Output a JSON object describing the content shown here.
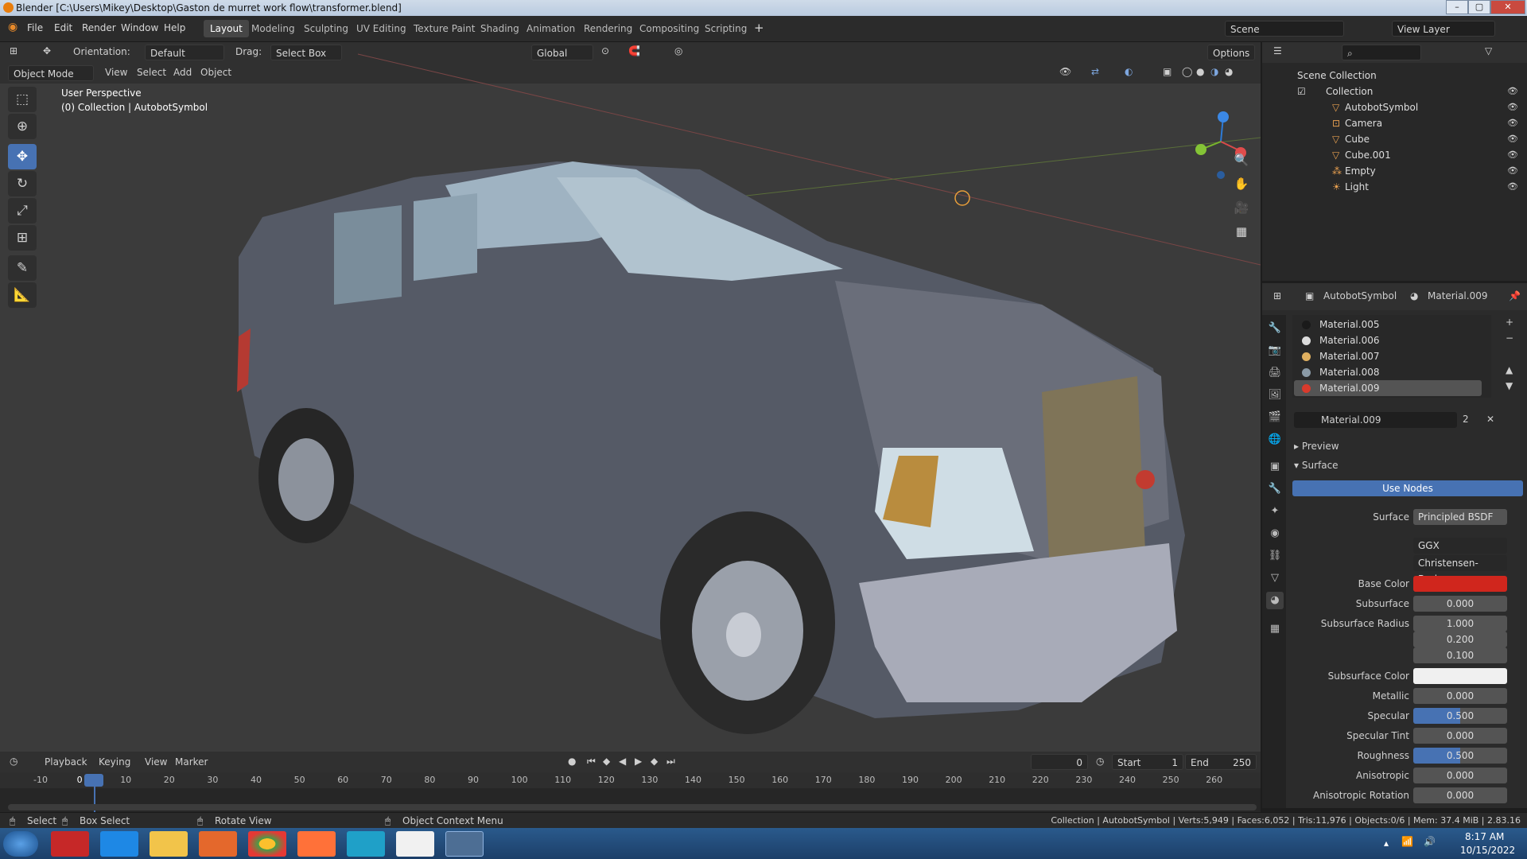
{
  "window": {
    "title": "Blender [C:\\Users\\Mikey\\Desktop\\Gaston de murret work flow\\transformer.blend]"
  },
  "menu": [
    "File",
    "Edit",
    "Render",
    "Window",
    "Help"
  ],
  "workspaces": [
    "Layout",
    "Modeling",
    "Sculpting",
    "UV Editing",
    "Texture Paint",
    "Shading",
    "Animation",
    "Rendering",
    "Compositing",
    "Scripting"
  ],
  "active_workspace": "Layout",
  "scene": {
    "label": "Scene",
    "view_layer": "View Layer"
  },
  "toolheader": {
    "orientation_label": "Orientation:",
    "orientation_value": "Default",
    "drag_label": "Drag:",
    "drag_value": "Select Box",
    "transform": "Global",
    "options": "Options"
  },
  "viewport": {
    "mode": "Object Mode",
    "menus": [
      "View",
      "Select",
      "Add",
      "Object"
    ],
    "info_line1": "User Perspective",
    "info_line2": "(0) Collection | AutobotSymbol"
  },
  "outliner": {
    "root": "Scene Collection",
    "collection": "Collection",
    "items": [
      "AutobotSymbol",
      "Camera",
      "Cube",
      "Cube.001",
      "Empty",
      "Light"
    ]
  },
  "properties": {
    "object": "AutobotSymbol",
    "material": "Material.009",
    "slots": [
      {
        "name": "Material.005",
        "color": "#1a1a1a"
      },
      {
        "name": "Material.006",
        "color": "#dcdcdc"
      },
      {
        "name": "Material.007",
        "color": "#e0b060"
      },
      {
        "name": "Material.008",
        "color": "#8a9aa6"
      },
      {
        "name": "Material.009",
        "color": "#d93a2c"
      }
    ],
    "material_field": "Material.009",
    "users": "2",
    "preview": "Preview",
    "surface_panel": "Surface",
    "use_nodes": "Use Nodes",
    "surface_label": "Surface",
    "surface_value": "Principled BSDF",
    "distribution": "GGX",
    "subsurface_method": "Christensen-Burley",
    "fields": [
      {
        "label": "Base Color",
        "value": "",
        "kind": "color",
        "color": "#d0261d"
      },
      {
        "label": "Subsurface",
        "value": "0.000"
      },
      {
        "label": "Subsurface Radius",
        "value": "1.000"
      },
      {
        "label": "",
        "value": "0.200"
      },
      {
        "label": "",
        "value": "0.100"
      },
      {
        "label": "Subsurface Color",
        "value": "",
        "kind": "color",
        "color": "#f0f0f0"
      },
      {
        "label": "Metallic",
        "value": "0.000"
      },
      {
        "label": "Specular",
        "value": "0.500",
        "kind": "slider"
      },
      {
        "label": "Specular Tint",
        "value": "0.000"
      },
      {
        "label": "Roughness",
        "value": "0.500",
        "kind": "slider"
      },
      {
        "label": "Anisotropic",
        "value": "0.000"
      },
      {
        "label": "Anisotropic Rotation",
        "value": "0.000"
      }
    ]
  },
  "timeline": {
    "menus": [
      "Playback",
      "Keying",
      "View",
      "Marker"
    ],
    "current_frame": "0",
    "start_label": "Start",
    "start": "1",
    "end_label": "End",
    "end": "250",
    "ticks": [
      "-10",
      "0",
      "10",
      "20",
      "30",
      "40",
      "50",
      "60",
      "70",
      "80",
      "90",
      "100",
      "110",
      "120",
      "130",
      "140",
      "150",
      "160",
      "170",
      "180",
      "190",
      "200",
      "210",
      "220",
      "230",
      "240",
      "250",
      "260"
    ]
  },
  "statusbar": {
    "select": "Select",
    "box_select": "Box Select",
    "rotate": "Rotate View",
    "context": "Object Context Menu",
    "stats": "Collection | AutobotSymbol | Verts:5,949 | Faces:6,052 | Tris:11,976 | Objects:0/6 | Mem: 37.4 MiB | 2.83.16"
  },
  "taskbar": {
    "time": "8:17 AM",
    "date": "10/15/2022"
  }
}
